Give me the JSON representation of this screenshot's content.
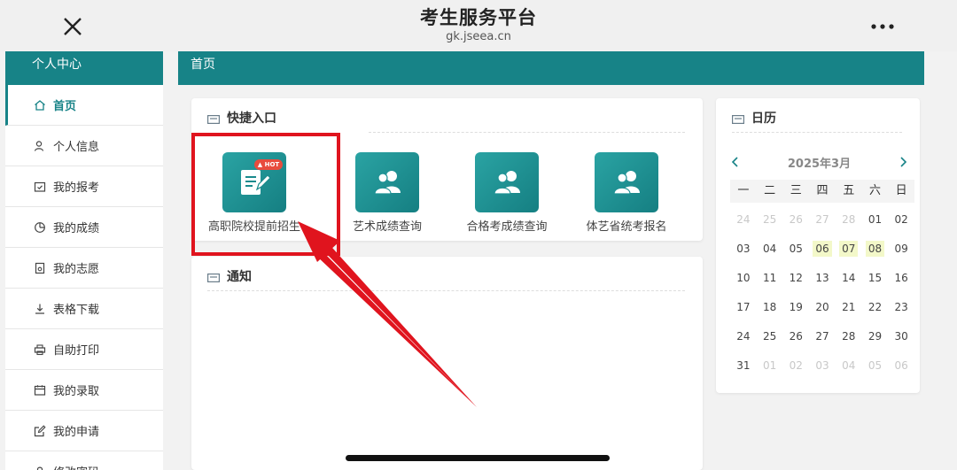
{
  "topbar": {
    "title": "考生服务平台",
    "domain": "gk.jseea.cn"
  },
  "sidebar": {
    "header": "个人中心",
    "items": [
      {
        "label": "首页",
        "icon": "home-icon"
      },
      {
        "label": "个人信息",
        "icon": "user-icon"
      },
      {
        "label": "我的报考",
        "icon": "calendar-check-icon"
      },
      {
        "label": "我的成绩",
        "icon": "pie-chart-icon"
      },
      {
        "label": "我的志愿",
        "icon": "document-icon"
      },
      {
        "label": "表格下载",
        "icon": "download-icon"
      },
      {
        "label": "自助打印",
        "icon": "printer-icon"
      },
      {
        "label": "我的录取",
        "icon": "calendar-icon"
      },
      {
        "label": "我的申请",
        "icon": "edit-icon"
      },
      {
        "label": "修改密码",
        "icon": "lock-icon"
      }
    ]
  },
  "main": {
    "header": "首页"
  },
  "quick": {
    "title": "快捷入口",
    "hot": "HOT",
    "items": [
      {
        "label": "高职院校提前招生",
        "icon": "edit-document-icon"
      },
      {
        "label": "艺术成绩查询",
        "icon": "users-icon"
      },
      {
        "label": "合格考成绩查询",
        "icon": "users-icon"
      },
      {
        "label": "体艺省统考报名",
        "icon": "users-icon"
      }
    ]
  },
  "notice": {
    "title": "通知"
  },
  "calendar": {
    "title": "日历",
    "month": "2025年3月",
    "weekdays": [
      "一",
      "二",
      "三",
      "四",
      "五",
      "六",
      "日"
    ],
    "weeks": [
      [
        "24",
        "25",
        "26",
        "27",
        "28",
        "01",
        "02"
      ],
      [
        "03",
        "04",
        "05",
        "06",
        "07",
        "08",
        "09"
      ],
      [
        "10",
        "11",
        "12",
        "13",
        "14",
        "15",
        "16"
      ],
      [
        "17",
        "18",
        "19",
        "20",
        "21",
        "22",
        "23"
      ],
      [
        "24",
        "25",
        "26",
        "27",
        "28",
        "29",
        "30"
      ],
      [
        "31",
        "01",
        "02",
        "03",
        "04",
        "05",
        "06"
      ]
    ],
    "highlighted": [
      "06",
      "07",
      "08"
    ]
  },
  "colors": {
    "brand": "#178387",
    "highlight": "#e0141e"
  }
}
